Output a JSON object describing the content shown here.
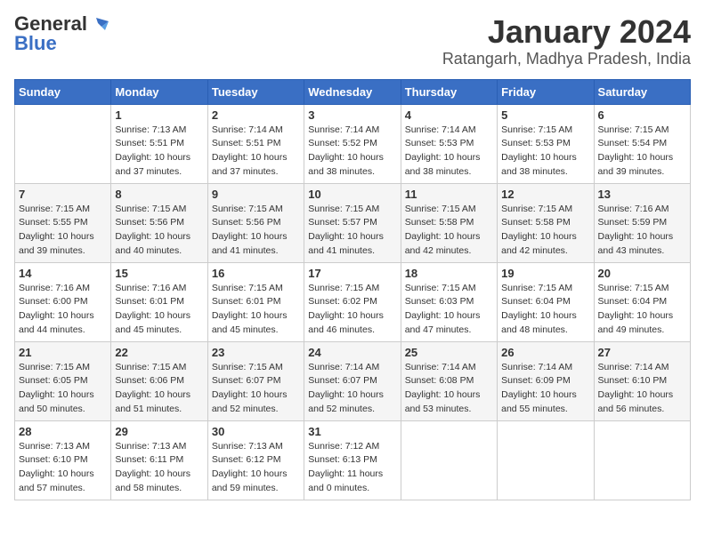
{
  "logo": {
    "general": "General",
    "blue": "Blue"
  },
  "title": "January 2024",
  "location": "Ratangarh, Madhya Pradesh, India",
  "days_of_week": [
    "Sunday",
    "Monday",
    "Tuesday",
    "Wednesday",
    "Thursday",
    "Friday",
    "Saturday"
  ],
  "weeks": [
    [
      {
        "day": "",
        "info": ""
      },
      {
        "day": "1",
        "info": "Sunrise: 7:13 AM\nSunset: 5:51 PM\nDaylight: 10 hours\nand 37 minutes."
      },
      {
        "day": "2",
        "info": "Sunrise: 7:14 AM\nSunset: 5:51 PM\nDaylight: 10 hours\nand 37 minutes."
      },
      {
        "day": "3",
        "info": "Sunrise: 7:14 AM\nSunset: 5:52 PM\nDaylight: 10 hours\nand 38 minutes."
      },
      {
        "day": "4",
        "info": "Sunrise: 7:14 AM\nSunset: 5:53 PM\nDaylight: 10 hours\nand 38 minutes."
      },
      {
        "day": "5",
        "info": "Sunrise: 7:15 AM\nSunset: 5:53 PM\nDaylight: 10 hours\nand 38 minutes."
      },
      {
        "day": "6",
        "info": "Sunrise: 7:15 AM\nSunset: 5:54 PM\nDaylight: 10 hours\nand 39 minutes."
      }
    ],
    [
      {
        "day": "7",
        "info": "Sunrise: 7:15 AM\nSunset: 5:55 PM\nDaylight: 10 hours\nand 39 minutes."
      },
      {
        "day": "8",
        "info": "Sunrise: 7:15 AM\nSunset: 5:56 PM\nDaylight: 10 hours\nand 40 minutes."
      },
      {
        "day": "9",
        "info": "Sunrise: 7:15 AM\nSunset: 5:56 PM\nDaylight: 10 hours\nand 41 minutes."
      },
      {
        "day": "10",
        "info": "Sunrise: 7:15 AM\nSunset: 5:57 PM\nDaylight: 10 hours\nand 41 minutes."
      },
      {
        "day": "11",
        "info": "Sunrise: 7:15 AM\nSunset: 5:58 PM\nDaylight: 10 hours\nand 42 minutes."
      },
      {
        "day": "12",
        "info": "Sunrise: 7:15 AM\nSunset: 5:58 PM\nDaylight: 10 hours\nand 42 minutes."
      },
      {
        "day": "13",
        "info": "Sunrise: 7:16 AM\nSunset: 5:59 PM\nDaylight: 10 hours\nand 43 minutes."
      }
    ],
    [
      {
        "day": "14",
        "info": "Sunrise: 7:16 AM\nSunset: 6:00 PM\nDaylight: 10 hours\nand 44 minutes."
      },
      {
        "day": "15",
        "info": "Sunrise: 7:16 AM\nSunset: 6:01 PM\nDaylight: 10 hours\nand 45 minutes."
      },
      {
        "day": "16",
        "info": "Sunrise: 7:15 AM\nSunset: 6:01 PM\nDaylight: 10 hours\nand 45 minutes."
      },
      {
        "day": "17",
        "info": "Sunrise: 7:15 AM\nSunset: 6:02 PM\nDaylight: 10 hours\nand 46 minutes."
      },
      {
        "day": "18",
        "info": "Sunrise: 7:15 AM\nSunset: 6:03 PM\nDaylight: 10 hours\nand 47 minutes."
      },
      {
        "day": "19",
        "info": "Sunrise: 7:15 AM\nSunset: 6:04 PM\nDaylight: 10 hours\nand 48 minutes."
      },
      {
        "day": "20",
        "info": "Sunrise: 7:15 AM\nSunset: 6:04 PM\nDaylight: 10 hours\nand 49 minutes."
      }
    ],
    [
      {
        "day": "21",
        "info": "Sunrise: 7:15 AM\nSunset: 6:05 PM\nDaylight: 10 hours\nand 50 minutes."
      },
      {
        "day": "22",
        "info": "Sunrise: 7:15 AM\nSunset: 6:06 PM\nDaylight: 10 hours\nand 51 minutes."
      },
      {
        "day": "23",
        "info": "Sunrise: 7:15 AM\nSunset: 6:07 PM\nDaylight: 10 hours\nand 52 minutes."
      },
      {
        "day": "24",
        "info": "Sunrise: 7:14 AM\nSunset: 6:07 PM\nDaylight: 10 hours\nand 52 minutes."
      },
      {
        "day": "25",
        "info": "Sunrise: 7:14 AM\nSunset: 6:08 PM\nDaylight: 10 hours\nand 53 minutes."
      },
      {
        "day": "26",
        "info": "Sunrise: 7:14 AM\nSunset: 6:09 PM\nDaylight: 10 hours\nand 55 minutes."
      },
      {
        "day": "27",
        "info": "Sunrise: 7:14 AM\nSunset: 6:10 PM\nDaylight: 10 hours\nand 56 minutes."
      }
    ],
    [
      {
        "day": "28",
        "info": "Sunrise: 7:13 AM\nSunset: 6:10 PM\nDaylight: 10 hours\nand 57 minutes."
      },
      {
        "day": "29",
        "info": "Sunrise: 7:13 AM\nSunset: 6:11 PM\nDaylight: 10 hours\nand 58 minutes."
      },
      {
        "day": "30",
        "info": "Sunrise: 7:13 AM\nSunset: 6:12 PM\nDaylight: 10 hours\nand 59 minutes."
      },
      {
        "day": "31",
        "info": "Sunrise: 7:12 AM\nSunset: 6:13 PM\nDaylight: 11 hours\nand 0 minutes."
      },
      {
        "day": "",
        "info": ""
      },
      {
        "day": "",
        "info": ""
      },
      {
        "day": "",
        "info": ""
      }
    ]
  ]
}
